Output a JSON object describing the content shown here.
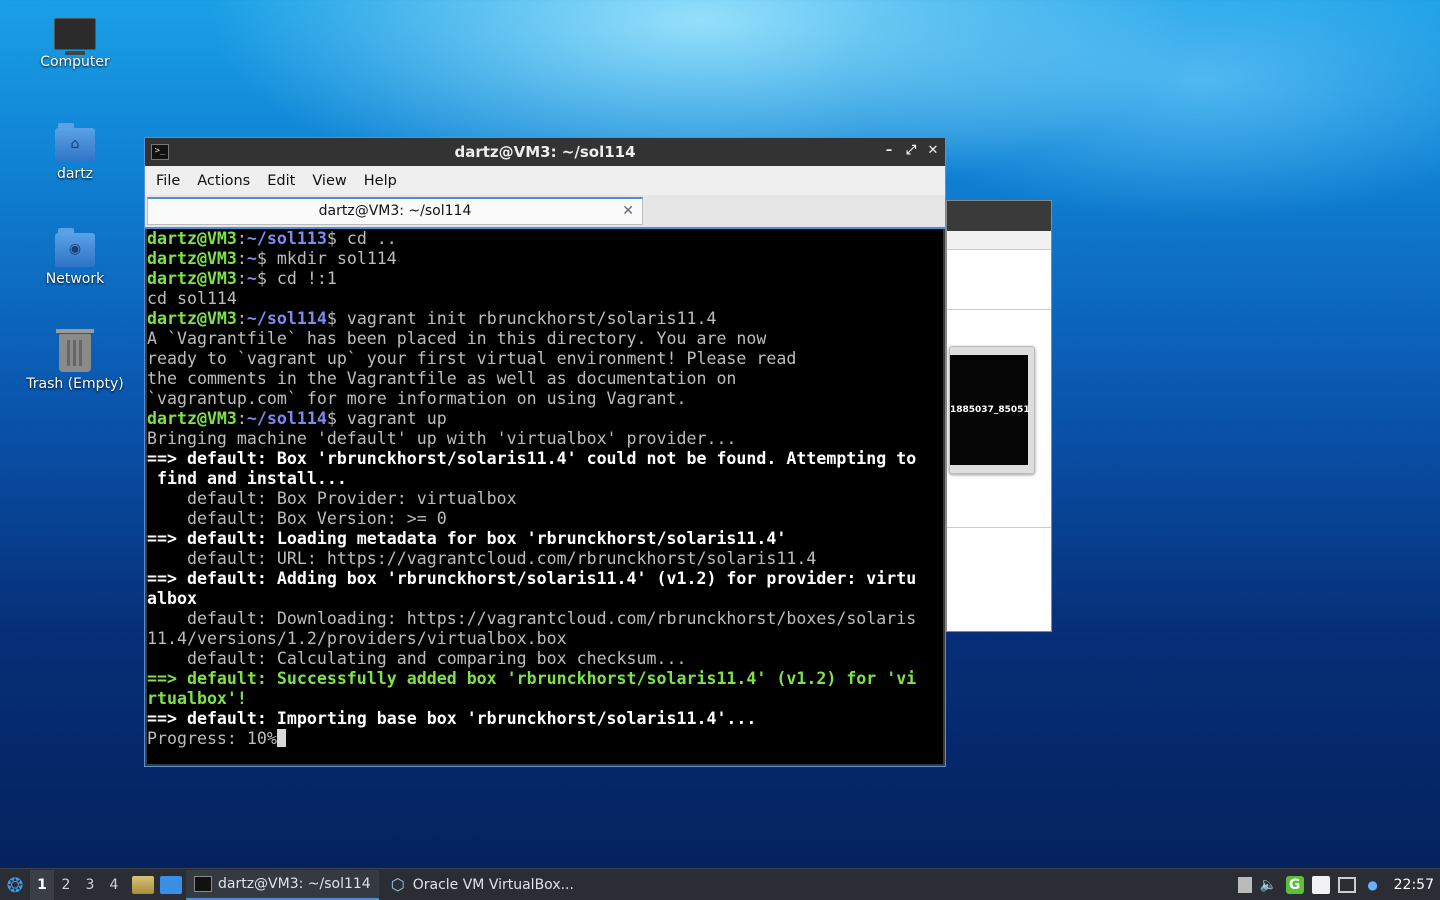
{
  "desktop": {
    "icons": [
      {
        "label": "Computer",
        "icon": "computer-icon"
      },
      {
        "label": "dartz",
        "icon": "home-folder-icon"
      },
      {
        "label": "Network",
        "icon": "network-folder-icon"
      },
      {
        "label": "Trash (Empty)",
        "icon": "trash-icon"
      }
    ]
  },
  "background_window": {
    "preview_label": "1885037_85051"
  },
  "terminal": {
    "title": "dartz@VM3: ~/sol114",
    "menu": [
      "File",
      "Actions",
      "Edit",
      "View",
      "Help"
    ],
    "tab_title": "dartz@VM3: ~/sol114",
    "lines": [
      [
        {
          "t": "dartz@VM3",
          "c": "u"
        },
        {
          "t": ":",
          "c": ""
        },
        {
          "t": "~/sol113",
          "c": "p"
        },
        {
          "t": "$ cd ..",
          "c": ""
        }
      ],
      [
        {
          "t": "dartz@VM3",
          "c": "u"
        },
        {
          "t": ":",
          "c": ""
        },
        {
          "t": "~",
          "c": "p"
        },
        {
          "t": "$ mkdir sol114",
          "c": ""
        }
      ],
      [
        {
          "t": "dartz@VM3",
          "c": "u"
        },
        {
          "t": ":",
          "c": ""
        },
        {
          "t": "~",
          "c": "p"
        },
        {
          "t": "$ cd !:1",
          "c": ""
        }
      ],
      [
        {
          "t": "cd sol114",
          "c": ""
        }
      ],
      [
        {
          "t": "dartz@VM3",
          "c": "u"
        },
        {
          "t": ":",
          "c": ""
        },
        {
          "t": "~/sol114",
          "c": "p"
        },
        {
          "t": "$ vagrant init rbrunckhorst/solaris11.4",
          "c": ""
        }
      ],
      [
        {
          "t": "A `Vagrantfile` has been placed in this directory. You are now",
          "c": ""
        }
      ],
      [
        {
          "t": "ready to `vagrant up` your first virtual environment! Please read",
          "c": ""
        }
      ],
      [
        {
          "t": "the comments in the Vagrantfile as well as documentation on",
          "c": ""
        }
      ],
      [
        {
          "t": "`vagrantup.com` for more information on using Vagrant.",
          "c": ""
        }
      ],
      [
        {
          "t": "dartz@VM3",
          "c": "u"
        },
        {
          "t": ":",
          "c": ""
        },
        {
          "t": "~/sol114",
          "c": "p"
        },
        {
          "t": "$ vagrant up",
          "c": ""
        }
      ],
      [
        {
          "t": "Bringing machine 'default' up with 'virtualbox' provider...",
          "c": ""
        }
      ],
      [
        {
          "t": "==> default: Box 'rbrunckhorst/solaris11.4' could not be found. Attempting to",
          "c": "w"
        }
      ],
      [
        {
          "t": " find and install...",
          "c": "w"
        }
      ],
      [
        {
          "t": "    default: Box Provider: virtualbox",
          "c": ""
        }
      ],
      [
        {
          "t": "    default: Box Version: >= 0",
          "c": ""
        }
      ],
      [
        {
          "t": "==> default: Loading metadata for box 'rbrunckhorst/solaris11.4'",
          "c": "w"
        }
      ],
      [
        {
          "t": "    default: URL: https://vagrantcloud.com/rbrunckhorst/solaris11.4",
          "c": ""
        }
      ],
      [
        {
          "t": "==> default: Adding box 'rbrunckhorst/solaris11.4' (v1.2) for provider: virtu",
          "c": "w"
        }
      ],
      [
        {
          "t": "albox",
          "c": "w"
        }
      ],
      [
        {
          "t": "    default: Downloading: https://vagrantcloud.com/rbrunckhorst/boxes/solaris",
          "c": ""
        }
      ],
      [
        {
          "t": "11.4/versions/1.2/providers/virtualbox.box",
          "c": ""
        }
      ],
      [
        {
          "t": "    default: Calculating and comparing box checksum...",
          "c": ""
        }
      ],
      [
        {
          "t": "==> default: Successfully added box 'rbrunckhorst/solaris11.4' (v1.2) for 'vi",
          "c": "g"
        }
      ],
      [
        {
          "t": "rtualbox'!",
          "c": "g"
        }
      ],
      [
        {
          "t": "==> default: Importing base box 'rbrunckhorst/solaris11.4'...",
          "c": "w"
        }
      ],
      [
        {
          "t": "Progress: 10%",
          "c": ""
        }
      ]
    ]
  },
  "taskbar": {
    "workspaces": [
      "1",
      "2",
      "3",
      "4"
    ],
    "active_workspace": "1",
    "tasks": [
      {
        "label": "dartz@VM3: ~/sol114",
        "icon": "terminal-icon",
        "active": true
      },
      {
        "label": "Oracle VM VirtualBox...",
        "icon": "virtualbox-icon",
        "active": false
      }
    ],
    "clock": "22:57"
  },
  "colors": {
    "prompt_user": "#7ee24a",
    "prompt_path": "#7a8cf2",
    "accent": "#4a90d9"
  }
}
